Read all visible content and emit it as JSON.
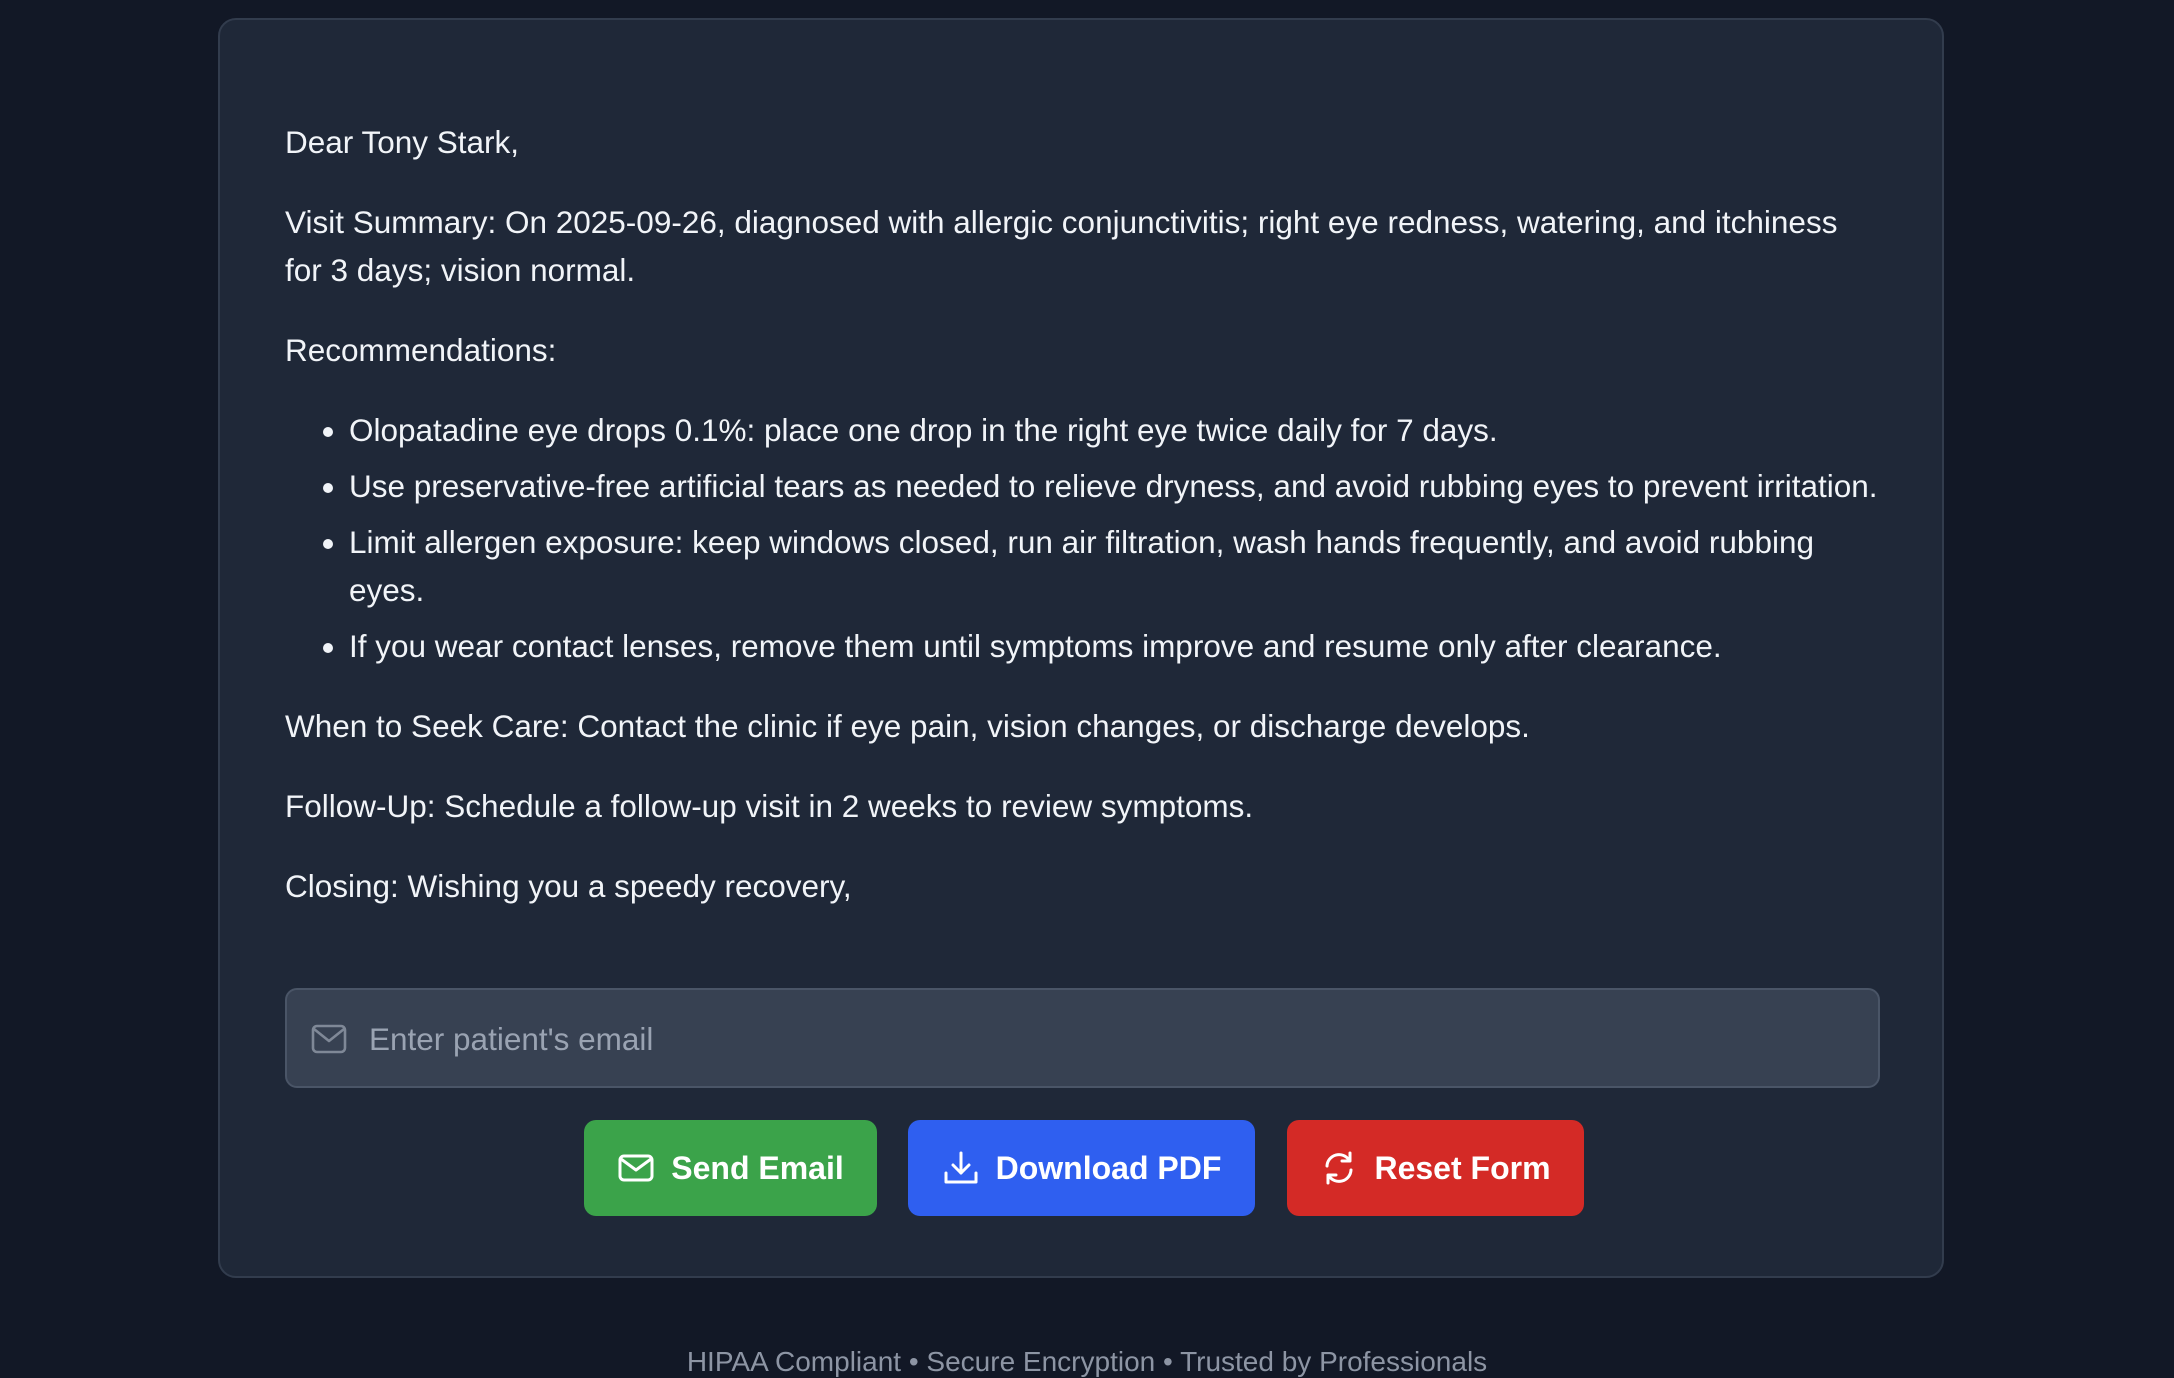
{
  "letter": {
    "greeting": "Dear Tony Stark,",
    "visit_summary": "Visit Summary: On 2025-09-26, diagnosed with allergic conjunctivitis; right eye redness, watering, and itchiness for 3 days; vision normal.",
    "recommendations_heading": "Recommendations:",
    "recommendations": [
      "Olopatadine eye drops 0.1%: place one drop in the right eye twice daily for 7 days.",
      "Use preservative-free artificial tears as needed to relieve dryness, and avoid rubbing eyes to prevent irritation.",
      "Limit allergen exposure: keep windows closed, run air filtration, wash hands frequently, and avoid rubbing eyes.",
      "If you wear contact lenses, remove them until symptoms improve and resume only after clearance."
    ],
    "seek_care": "When to Seek Care: Contact the clinic if eye pain, vision changes, or discharge develops.",
    "follow_up": "Follow-Up: Schedule a follow-up visit in 2 weeks to review symptoms.",
    "closing": "Closing: Wishing you a speedy recovery,"
  },
  "email": {
    "placeholder": "Enter patient's email",
    "value": "",
    "icon": "mail-icon"
  },
  "actions": {
    "send_label": "Send Email",
    "send_icon": "mail-icon",
    "pdf_label": "Download PDF",
    "pdf_icon": "download-icon",
    "reset_label": "Reset Form",
    "reset_icon": "refresh-icon"
  },
  "colors": {
    "background": "#121826",
    "card": "#1f2838",
    "send": "#3ba34a",
    "pdf": "#2f5ff0",
    "reset": "#d42a26"
  },
  "footer": {
    "text": "HIPAA Compliant • Secure Encryption • Trusted by Professionals"
  }
}
